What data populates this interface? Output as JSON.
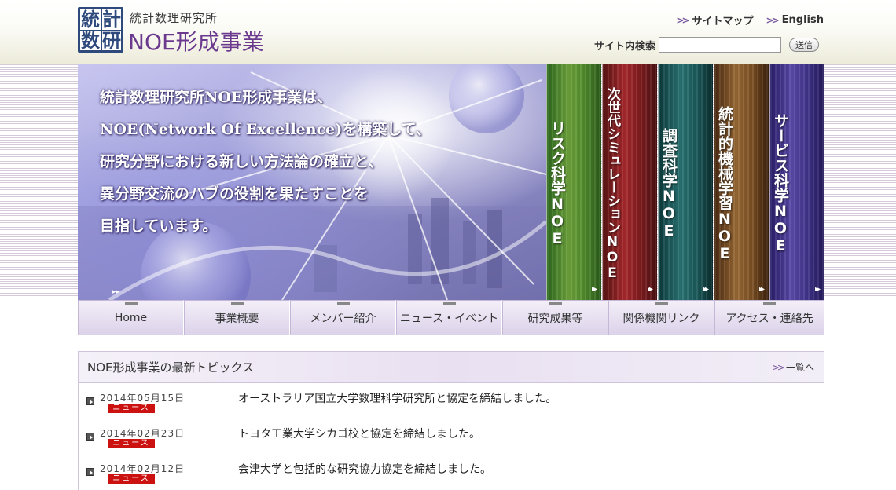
{
  "header": {
    "logo_mark": [
      "統",
      "計",
      "数",
      "研"
    ],
    "institute": "統計数理研究所",
    "project_title": "NOE形成事業",
    "links": [
      {
        "label": "サイトマップ"
      },
      {
        "label": "English"
      }
    ],
    "search": {
      "label": "サイト内検索",
      "value": "",
      "button": "送信"
    }
  },
  "hero": {
    "lines": [
      "統計数理研究所NOE形成事業は、",
      "NOE(Network Of Excellence)を構築して、",
      "研究分野における新しい方法論の確立と、",
      "異分野交流のハブの役割を果たすことを",
      "目指しています。"
    ]
  },
  "banners": [
    {
      "label": "リスク科学NOE",
      "color": "#4f8a2a"
    },
    {
      "label": "次世代シミュレーションNOE",
      "color": "#a8282c"
    },
    {
      "label": "調査科学NOE",
      "color": "#2a7474"
    },
    {
      "label": "統計的機械学習NOE",
      "color": "#9a6a34"
    },
    {
      "label": "サービス科学NOE",
      "color": "#5a4aaa"
    }
  ],
  "nav": [
    {
      "label": "Home"
    },
    {
      "label": "事業概要"
    },
    {
      "label": "メンバー紹介"
    },
    {
      "label": "ニュース・イベント"
    },
    {
      "label": "研究成果等"
    },
    {
      "label": "関係機関リンク"
    },
    {
      "label": "アクセス・連絡先"
    }
  ],
  "topics": {
    "title": "NOE形成事業の最新トピックス",
    "more": "一覧へ",
    "items": [
      {
        "date": "2014年05月15日",
        "badge": "ニュース",
        "text": "オーストラリア国立大学数理科学研究所と協定を締結しました。"
      },
      {
        "date": "2014年02月23日",
        "badge": "ニュース",
        "text": "トヨタ工業大学シカゴ校と協定を締結しました。"
      },
      {
        "date": "2014年02月12日",
        "badge": "ニュース",
        "text": "会津大学と包括的な研究協力協定を締結しました。"
      }
    ]
  },
  "colors": {
    "accent_purple": "#6b3a8f",
    "logo_blue": "#2e4a7d",
    "news_badge": "#cc1111"
  }
}
